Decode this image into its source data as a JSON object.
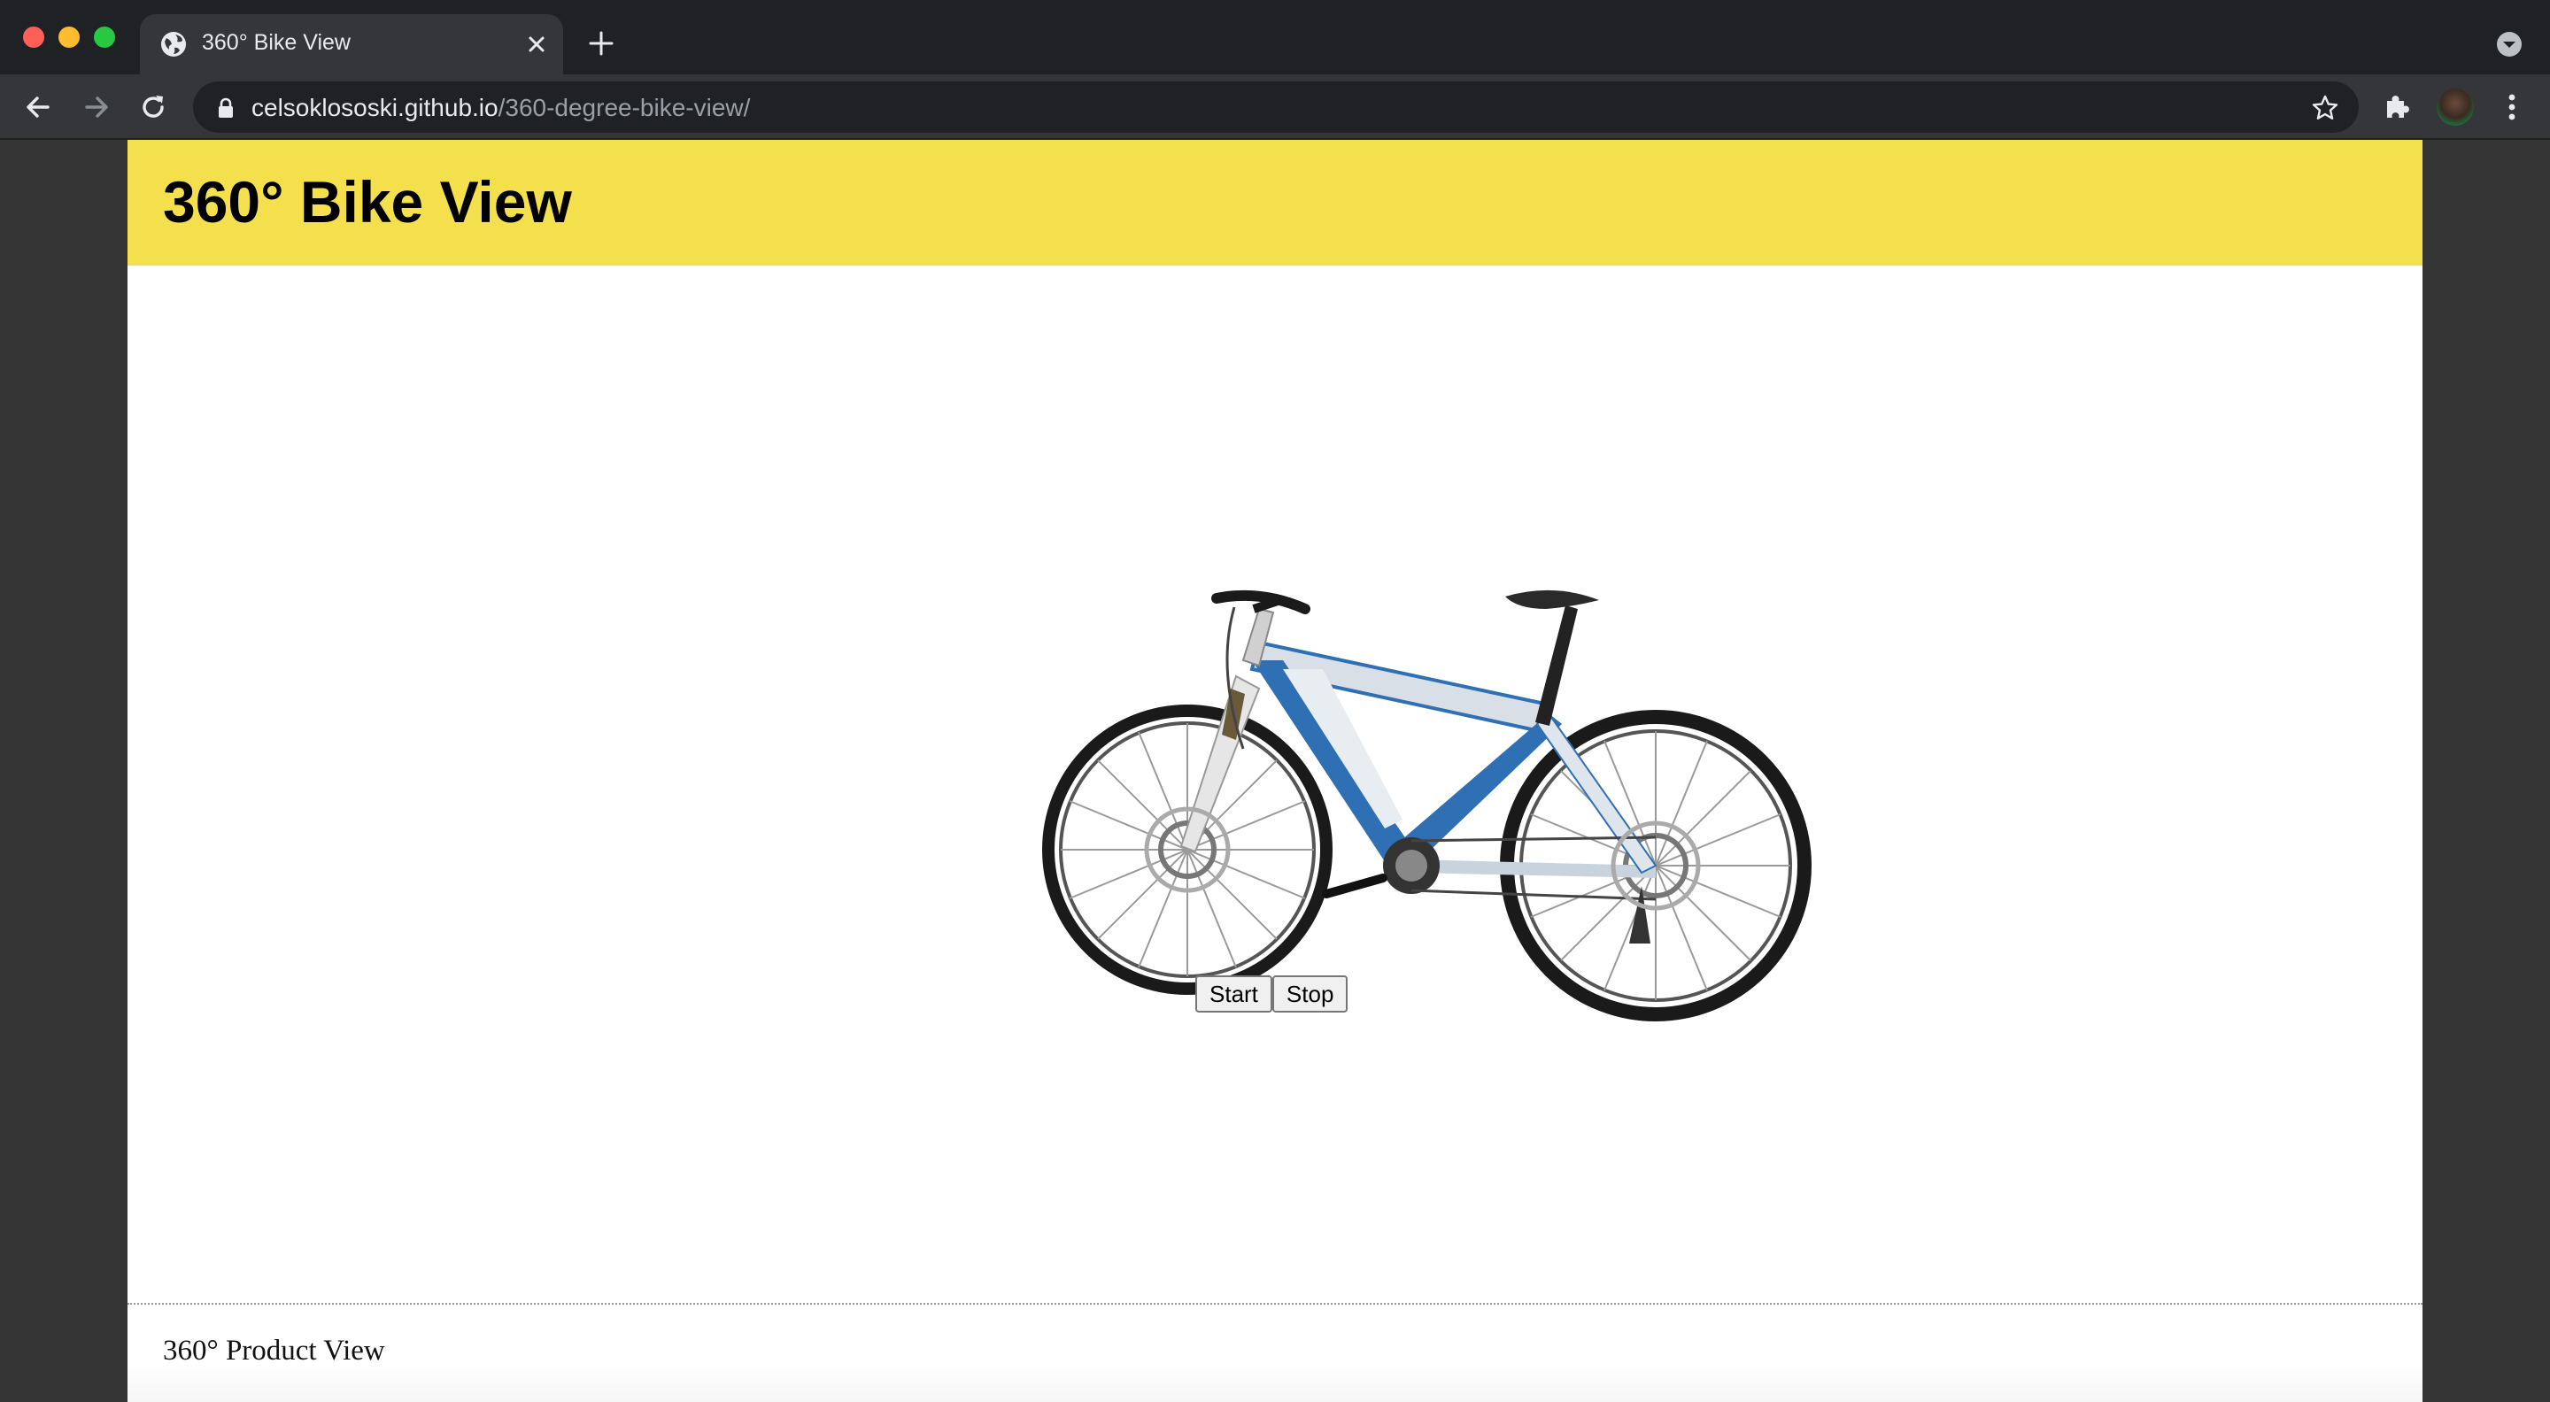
{
  "browser": {
    "tab_title": "360° Bike View",
    "url_host": "celsoklososki.github.io",
    "url_path": "/360-degree-bike-view/"
  },
  "page": {
    "heading": "360° Bike View",
    "start_label": "Start",
    "stop_label": "Stop",
    "footer_title": "360° Product View",
    "header_color": "#f4df4d",
    "frame_color": "#2f6fb3"
  },
  "icons": [
    "globe-icon",
    "close-icon",
    "plus-icon",
    "chevron-down-icon",
    "back-arrow-icon",
    "forward-arrow-icon",
    "reload-icon",
    "lock-icon",
    "star-icon",
    "puzzle-icon",
    "more-vert-icon"
  ]
}
